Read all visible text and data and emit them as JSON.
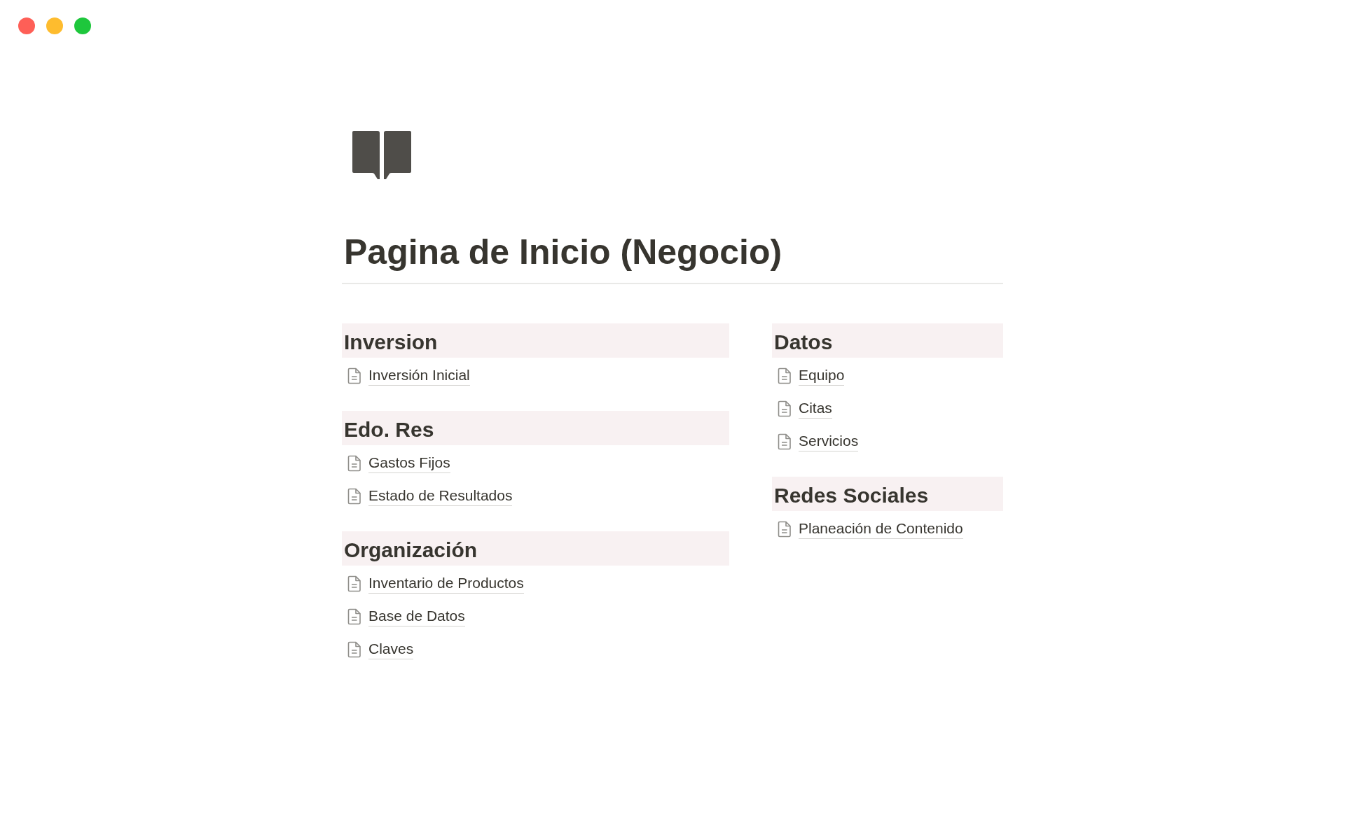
{
  "window": {
    "controls": [
      {
        "color": "#fe5f57"
      },
      {
        "color": "#febc2e"
      },
      {
        "color": "#1ec73c"
      }
    ]
  },
  "page": {
    "title": "Pagina de Inicio (Negocio)"
  },
  "columns": [
    {
      "sections": [
        {
          "heading": "Inversion",
          "links": [
            "Inversión Inicial"
          ]
        },
        {
          "heading": "Edo. Res",
          "links": [
            "Gastos Fijos",
            "Estado de Resultados"
          ]
        },
        {
          "heading": "Organización",
          "links": [
            "Inventario de Productos",
            "Base de Datos",
            "Claves"
          ]
        }
      ]
    },
    {
      "sections": [
        {
          "heading": "Datos",
          "links": [
            "Equipo",
            "Citas",
            "Servicios"
          ]
        },
        {
          "heading": "Redes Sociales",
          "links": [
            "Planeación de Contenido"
          ]
        }
      ]
    }
  ]
}
